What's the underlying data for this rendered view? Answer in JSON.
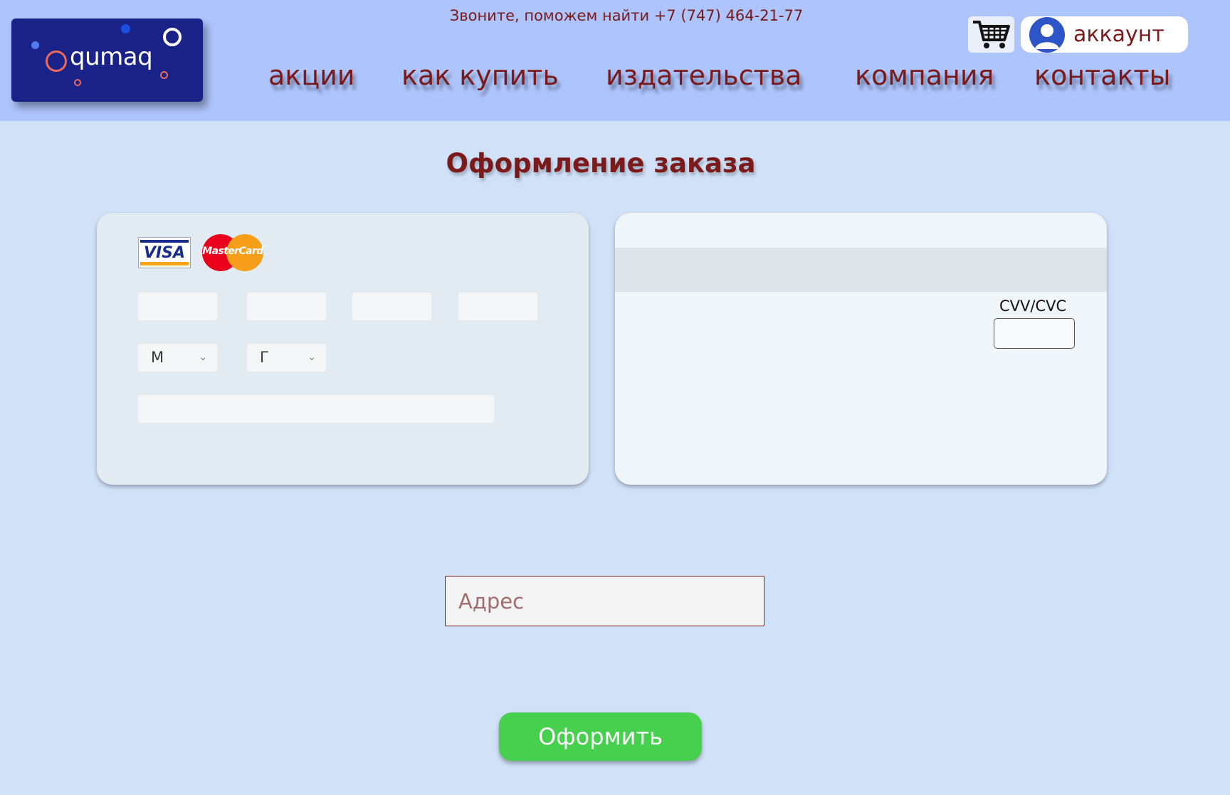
{
  "header": {
    "logo_text": "qumaq",
    "phone": "Звоните, поможем найти +7 (747) 464-21-77",
    "account_label": "аккаунт",
    "nav": [
      "акции",
      "как купить",
      "издательства",
      "компания",
      "контакты"
    ]
  },
  "main": {
    "title": "Оформление заказа",
    "card_front": {
      "brands": {
        "visa": "VISA",
        "mastercard": "MasterCard"
      },
      "month_select": "М",
      "year_select": "Г"
    },
    "card_back": {
      "cvv_label": "CVV/CVC"
    },
    "address_placeholder": "Адрес",
    "submit_label": "Оформить"
  },
  "colors": {
    "header_bg": "#adc4fc",
    "page_bg": "#d0e1f8",
    "logo_bg": "#1a2288",
    "text_accent": "#7a1a1a",
    "submit_bg": "#46d04e"
  },
  "icons": [
    "cart-icon",
    "user-avatar-icon",
    "chevron-down-icon"
  ]
}
